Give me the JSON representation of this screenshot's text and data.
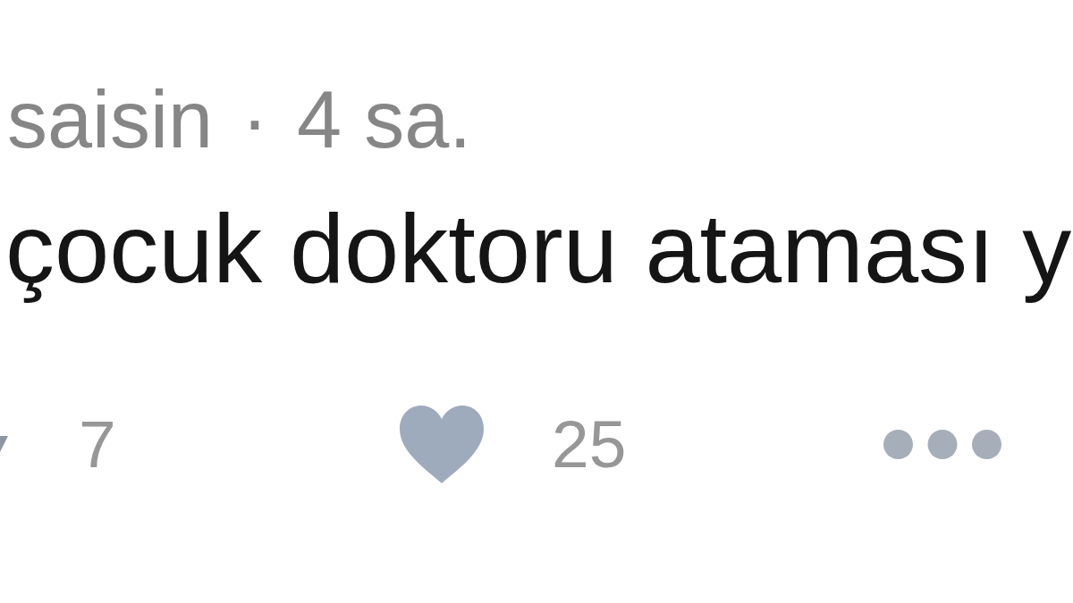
{
  "tweet": {
    "header": {
      "name": "saisin",
      "separator": "·",
      "time": "4 sa."
    },
    "text": "çocuk doktoru ataması y",
    "actions": [
      {
        "kind": "retweet",
        "count": "7"
      },
      {
        "kind": "like",
        "count": "25"
      },
      {
        "kind": "more"
      }
    ]
  }
}
